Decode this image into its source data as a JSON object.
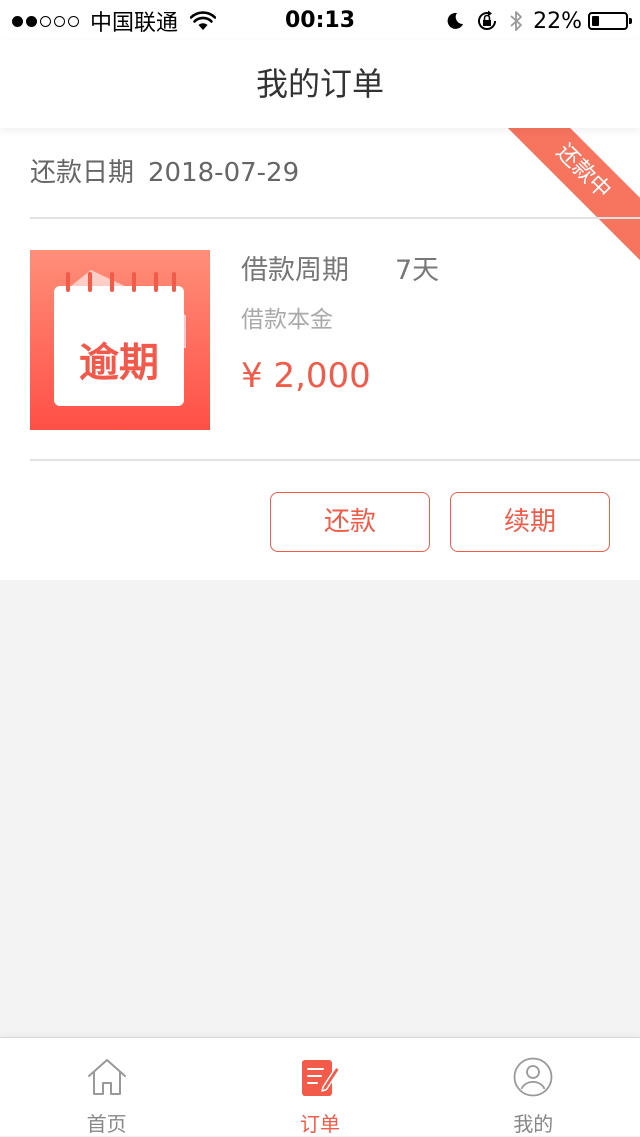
{
  "status_bar": {
    "carrier": "中国联通",
    "time": "00:13",
    "battery": "22%",
    "battery_level": 0.22
  },
  "nav": {
    "title": "我的订单"
  },
  "order": {
    "date_label": "还款日期",
    "date_value": "2018-07-29",
    "status_ribbon": "还款中",
    "badge_text": "逾期",
    "period_label": "借款周期",
    "period_value": "7天",
    "principal_label": "借款本金",
    "amount": "¥ 2,000",
    "repay_button": "还款",
    "renew_button": "续期"
  },
  "tabs": [
    {
      "label": "首页",
      "icon": "home-icon",
      "active": false
    },
    {
      "label": "订单",
      "icon": "order-edit-icon",
      "active": true
    },
    {
      "label": "我的",
      "icon": "user-profile-icon",
      "active": false
    }
  ],
  "colors": {
    "accent": "#f25b4a",
    "ribbon": "#f7745e",
    "background": "#f3f3f3"
  }
}
